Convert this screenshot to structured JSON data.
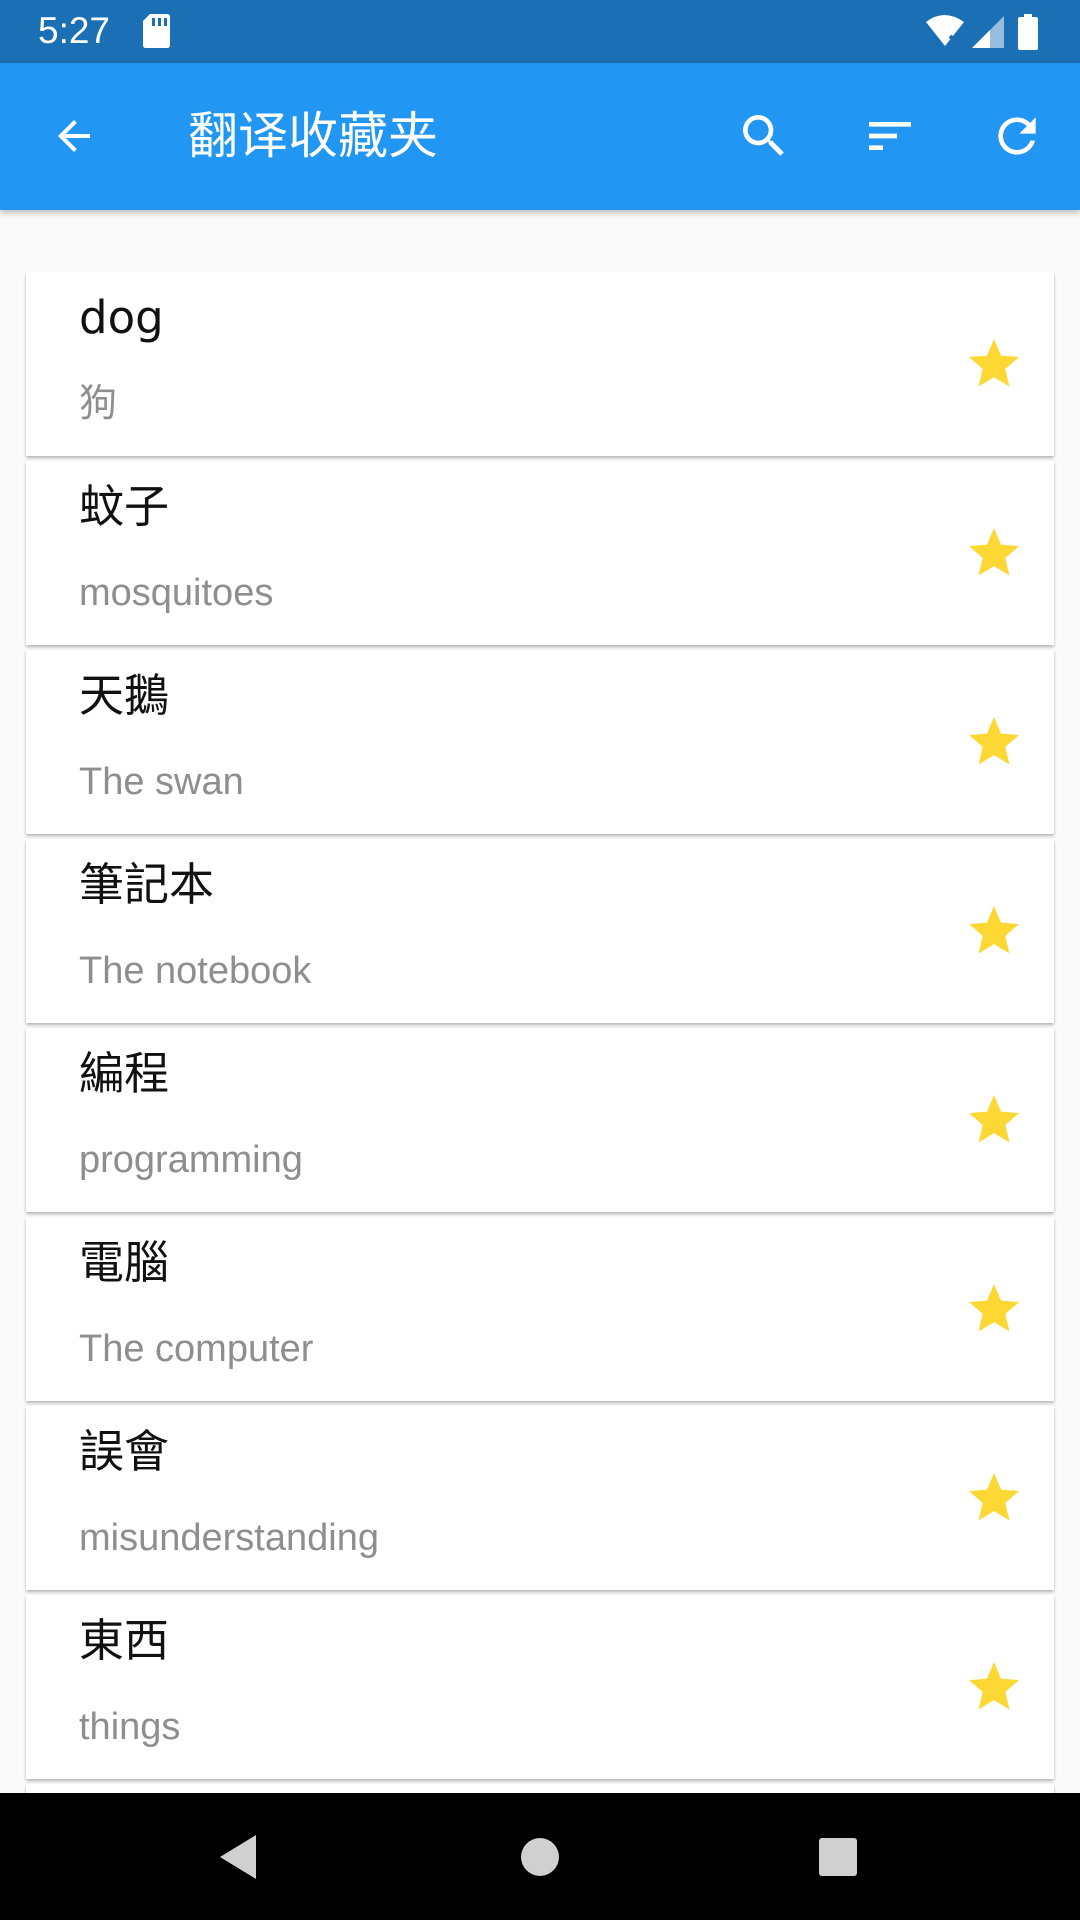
{
  "status_bar": {
    "time": "5:27"
  },
  "app_bar": {
    "title": "翻译收藏夹"
  },
  "colors": {
    "status_bar": "#1a6fb5",
    "app_bar": "#2196f3",
    "star": "#fdd835",
    "translation_text": "#8e8e8e"
  },
  "icons": {
    "back": "arrow-back-icon",
    "search": "search-icon",
    "sort": "sort-icon",
    "refresh": "refresh-icon",
    "favorite": "star-icon",
    "nav_back": "triangle-back-icon",
    "nav_home": "circle-home-icon",
    "nav_recents": "square-recents-icon"
  },
  "favorites": [
    {
      "word": "dog",
      "translation": "狗"
    },
    {
      "word": "蚊子",
      "translation": "mosquitoes"
    },
    {
      "word": "天鵝",
      "translation": "The swan"
    },
    {
      "word": "筆記本",
      "translation": "The notebook"
    },
    {
      "word": "編程",
      "translation": "programming"
    },
    {
      "word": "電腦",
      "translation": "The computer"
    },
    {
      "word": "誤會",
      "translation": "misunderstanding"
    },
    {
      "word": "東西",
      "translation": "things"
    }
  ]
}
